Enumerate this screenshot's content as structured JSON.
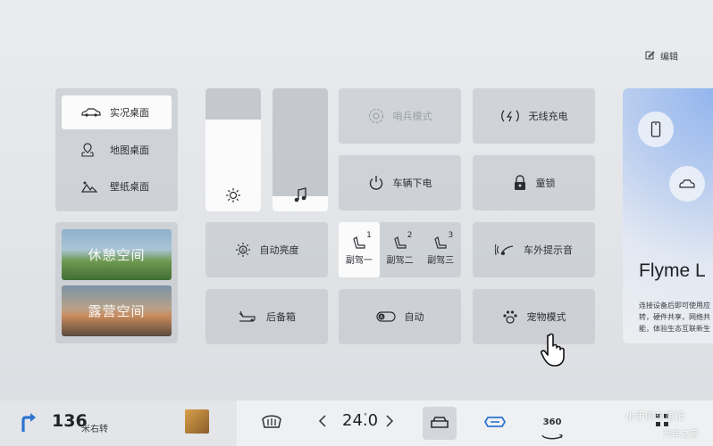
{
  "header": {
    "edit_label": "编辑"
  },
  "desktop_modes": [
    {
      "label": "实况桌面",
      "icon": "car-icon",
      "active": true
    },
    {
      "label": "地图桌面",
      "icon": "map-pin-icon",
      "active": false
    },
    {
      "label": "壁纸桌面",
      "icon": "mountain-image-icon",
      "active": false
    }
  ],
  "spaces": [
    {
      "label": "休憩空间"
    },
    {
      "label": "露营空间"
    }
  ],
  "sliders": {
    "brightness": {
      "icon": "sun-icon",
      "level": 0.75
    },
    "volume": {
      "icon": "music-note-icon",
      "level": 0.12
    }
  },
  "tiles": {
    "sentry_mode": "哨兵模式",
    "wireless_charging": "无线充电",
    "vehicle_power_off": "车辆下电",
    "child_lock": "童锁",
    "auto_brightness": "自动亮度",
    "external_sound": "车外提示音",
    "trunk": "后备箱",
    "auto": "自动",
    "pet_mode": "宠物模式"
  },
  "seats": [
    {
      "label": "副驾一",
      "num": "1",
      "active": true
    },
    {
      "label": "副驾二",
      "num": "2",
      "active": false
    },
    {
      "label": "副驾三",
      "num": "3",
      "active": false
    }
  ],
  "flyme": {
    "title": "Flyme L",
    "desc": "连接设备后即可使用应\n转，硬件共享，网络共\n能，体验生态互联新生"
  },
  "bottom_bar": {
    "distance": "136",
    "distance_unit": "米右转",
    "temperature": "24.0",
    "temp_label_360": "360"
  },
  "watermark": {
    "line1": "小手的车笔记",
    "line2": "汽车之家"
  },
  "colors": {
    "active": "#fbfbfc",
    "tile": "#c2c6cc",
    "nav_arrow": "#2f74d0",
    "accent_blue": "#2f74d0"
  }
}
